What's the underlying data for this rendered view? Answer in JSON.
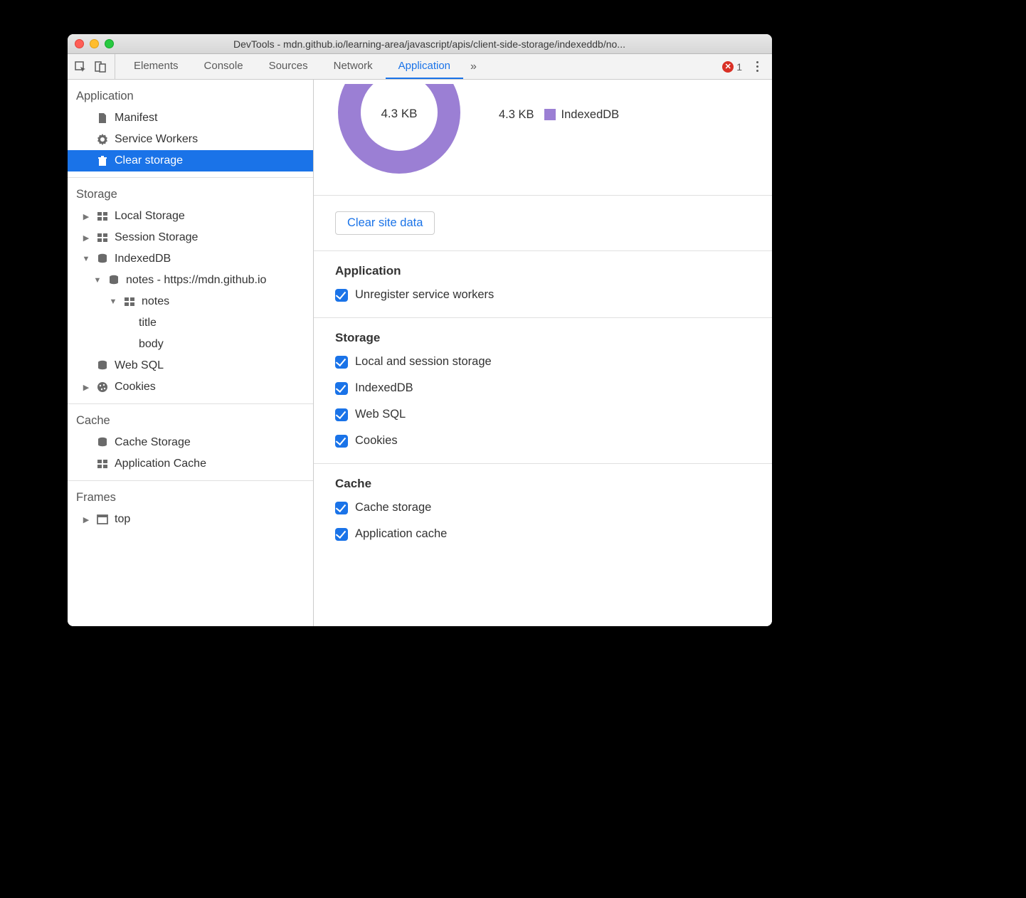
{
  "window": {
    "title": "DevTools - mdn.github.io/learning-area/javascript/apis/client-side-storage/indexeddb/no..."
  },
  "tabs": {
    "items": [
      "Elements",
      "Console",
      "Sources",
      "Network",
      "Application"
    ],
    "active_index": 4,
    "error_count": "1"
  },
  "sidebar": {
    "sections": {
      "application": {
        "header": "Application",
        "items": {
          "manifest": "Manifest",
          "service_workers": "Service Workers",
          "clear_storage": "Clear storage"
        }
      },
      "storage": {
        "header": "Storage",
        "items": {
          "local_storage": "Local Storage",
          "session_storage": "Session Storage",
          "indexeddb": "IndexedDB",
          "idb_db": "notes - https://mdn.github.io",
          "idb_store": "notes",
          "idb_field_title": "title",
          "idb_field_body": "body",
          "web_sql": "Web SQL",
          "cookies": "Cookies"
        }
      },
      "cache": {
        "header": "Cache",
        "items": {
          "cache_storage": "Cache Storage",
          "application_cache": "Application Cache"
        }
      },
      "frames": {
        "header": "Frames",
        "items": {
          "top": "top"
        }
      }
    }
  },
  "content": {
    "usage": {
      "total": "4.3 KB",
      "legend_size": "4.3 KB",
      "legend_label": "IndexedDB"
    },
    "clear_button": "Clear site data",
    "groups": {
      "application": {
        "header": "Application",
        "items": {
          "unregister_sw": "Unregister service workers"
        }
      },
      "storage": {
        "header": "Storage",
        "items": {
          "local_session": "Local and session storage",
          "indexeddb": "IndexedDB",
          "web_sql": "Web SQL",
          "cookies": "Cookies"
        }
      },
      "cache": {
        "header": "Cache",
        "items": {
          "cache_storage": "Cache storage",
          "application_cache": "Application cache"
        }
      }
    }
  },
  "colors": {
    "accent": "#1a73e8",
    "donut": "#9b7fd4"
  }
}
